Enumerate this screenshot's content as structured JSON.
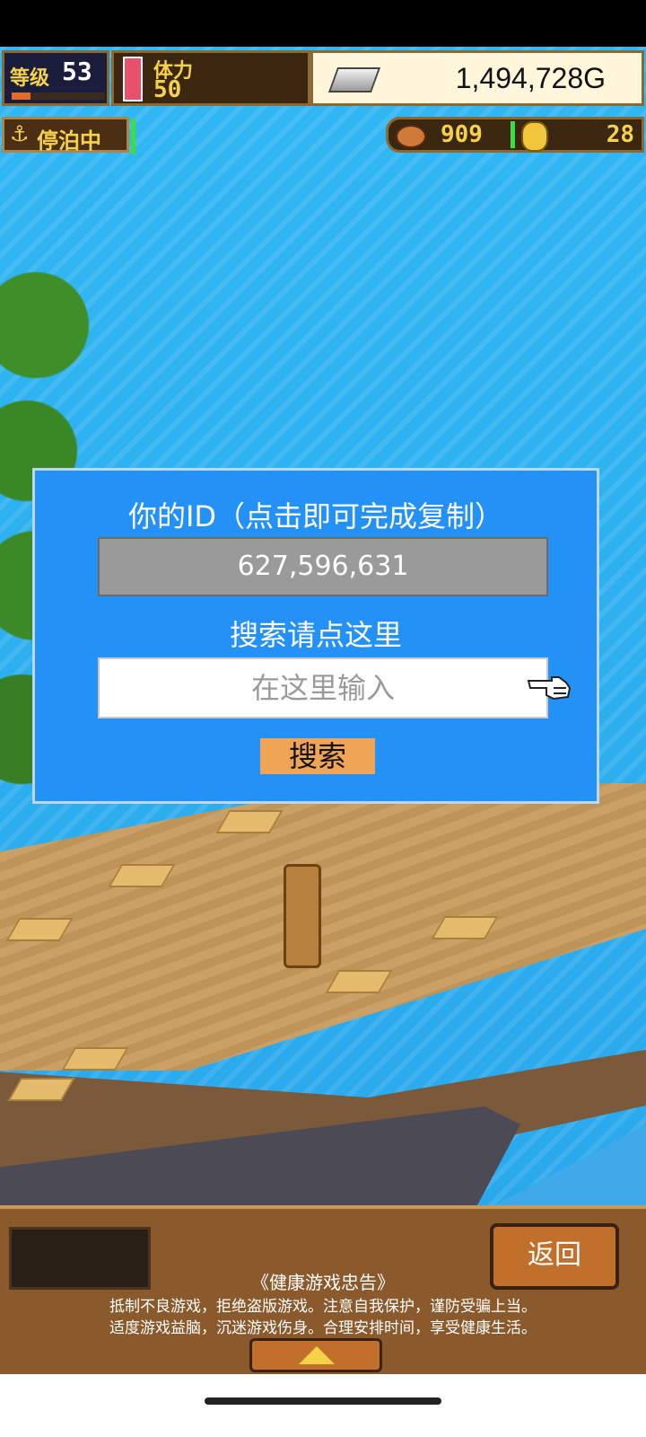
{
  "hud": {
    "level_label": "等级",
    "level_value": "53",
    "level_progress": 0.2,
    "stamina_label": "体力",
    "stamina_value": "50",
    "gold_value": "1,494,728G",
    "gold_icon": "silver-bar-icon",
    "status_label": "停泊中",
    "status_icon": "anchor-icon",
    "food_icon": "meat-icon",
    "food_value": "909",
    "medal_icon": "medal-icon",
    "medal_value": "28"
  },
  "dialog": {
    "title": "你的ID（点击即可完成复制）",
    "user_id": "627,596,631",
    "search_label": "搜索请点这里",
    "search_placeholder": "在这里输入",
    "search_button": "搜索",
    "pointer_icon": "pointing-hand-icon"
  },
  "bottom": {
    "back_button": "返回",
    "advice_title": "《健康游戏忠告》",
    "advice_line_1": "抵制不良游戏，拒绝盗版游戏。注意自我保护，谨防受骗上当。",
    "advice_line_2": "适度游戏益脑，沉迷游戏伤身。合理安排时间，享受健康生活。",
    "expand_icon": "up-arrow-icon"
  },
  "colors": {
    "dialog_bg": "#2391f5",
    "search_button_bg": "#f0a556",
    "hud_text": "#f6d24a"
  }
}
